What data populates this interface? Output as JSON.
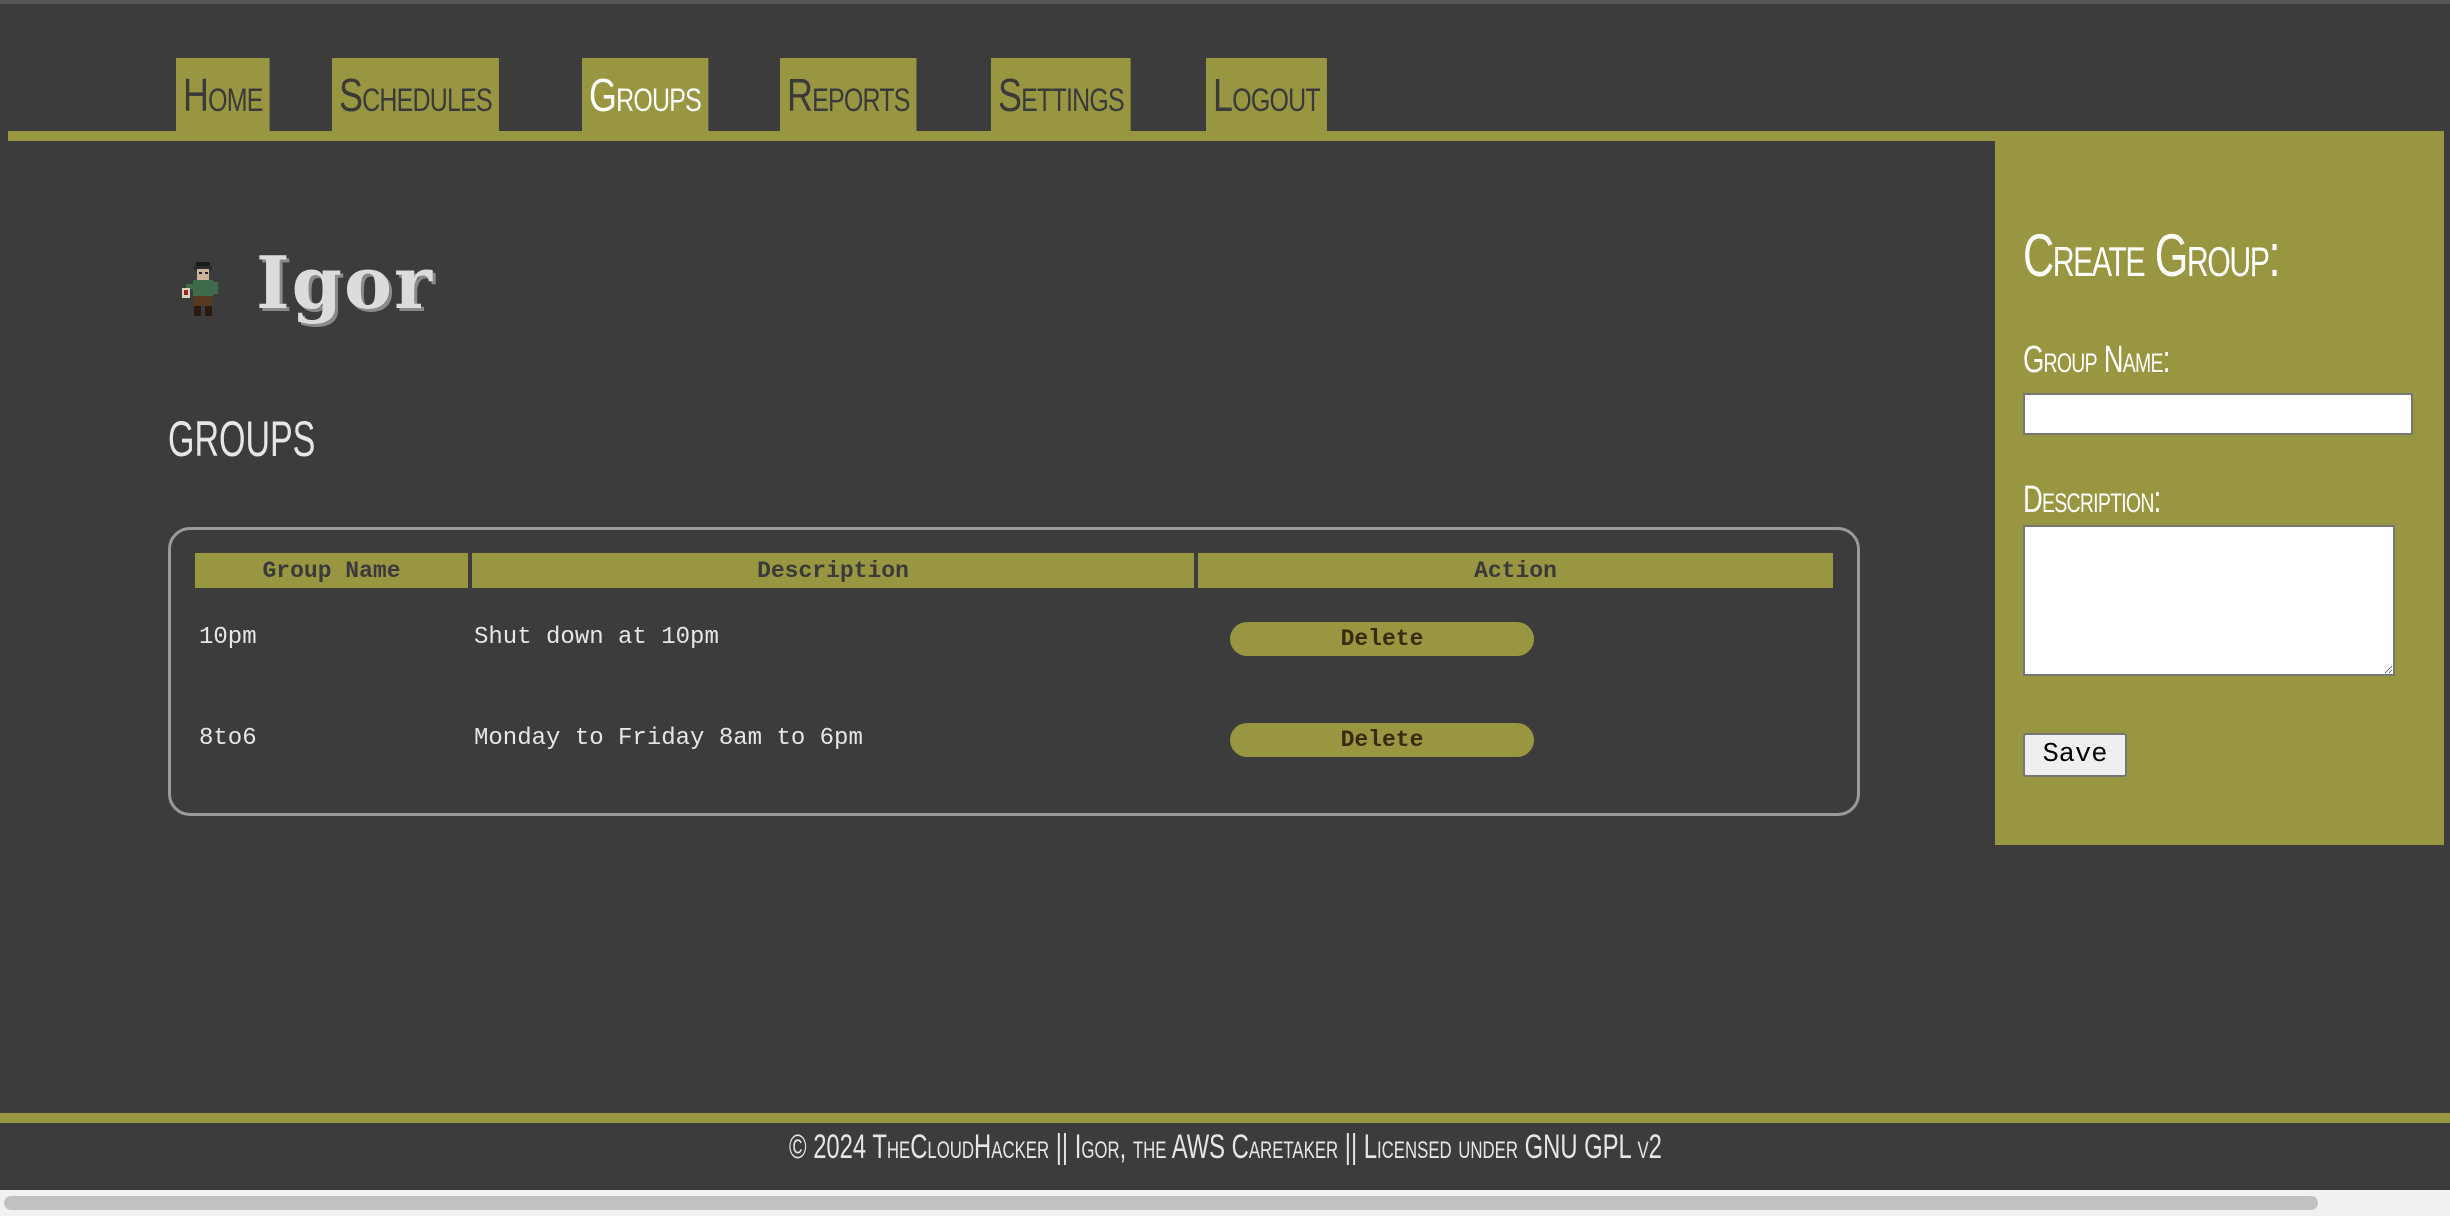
{
  "nav": {
    "tabs": [
      {
        "label": "Home",
        "active": false
      },
      {
        "label": "Schedules",
        "active": false
      },
      {
        "label": "Groups",
        "active": true
      },
      {
        "label": "Reports",
        "active": false
      },
      {
        "label": "Settings",
        "active": false
      },
      {
        "label": "Logout",
        "active": false
      }
    ]
  },
  "logo": {
    "text": "Igor",
    "icon": "igor-character-icon"
  },
  "page": {
    "title": "GROUPS"
  },
  "table": {
    "headers": [
      "Group Name",
      "Description",
      "Action"
    ],
    "rows": [
      {
        "name": "10pm",
        "description": "Shut down at 10pm",
        "action": "Delete"
      },
      {
        "name": "8to6",
        "description": "Monday to Friday 8am to 6pm",
        "action": "Delete"
      }
    ]
  },
  "sidebar": {
    "title": "Create Group:",
    "name_label": "Group Name:",
    "name_value": "",
    "description_label": "Description:",
    "description_value": "",
    "save_label": "Save"
  },
  "footer": {
    "text": "© 2024 TheCloudHacker || Igor, the AWS Caretaker || Licensed under GNU GPL v2"
  },
  "colors": {
    "background": "#3c3c3c",
    "accent": "#989641",
    "text": "#e6e6e6"
  }
}
